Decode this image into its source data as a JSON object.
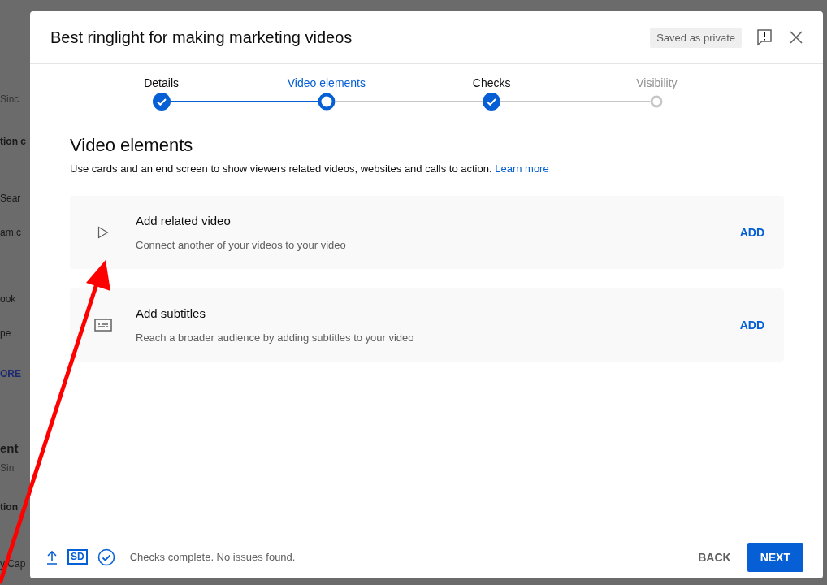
{
  "background_page": {
    "fragments": [
      {
        "text": "Sinc",
        "kind": "muted"
      },
      {
        "text": "tion c",
        "kind": "bold"
      },
      {
        "text": "Sear",
        "kind": "plain"
      },
      {
        "text": "am.c",
        "kind": "plain"
      },
      {
        "text": "ook",
        "kind": "plain"
      },
      {
        "text": "pe",
        "kind": "plain"
      },
      {
        "text": "ORE",
        "kind": "link"
      },
      {
        "text": "ent",
        "kind": "heading"
      },
      {
        "text": "Sin",
        "kind": "muted"
      },
      {
        "text": "tion",
        "kind": "bold"
      },
      {
        "text": "y Cap",
        "kind": "plain"
      }
    ]
  },
  "dialog": {
    "title": "Best ringlight for making marketing videos",
    "save_status": "Saved as private",
    "steps": [
      {
        "label": "Details",
        "completed": true,
        "selected": false
      },
      {
        "label": "Video elements",
        "completed": false,
        "selected": true
      },
      {
        "label": "Checks",
        "completed": true,
        "selected": false
      },
      {
        "label": "Visibility",
        "completed": false,
        "selected": false
      }
    ],
    "heading": "Video elements",
    "description": "Use cards and an end screen to show viewers related videos, websites and calls to action.",
    "learn_more": "Learn more",
    "elements": [
      {
        "kind": "video",
        "title": "Add related video",
        "subtitle": "Connect another of your videos to your video",
        "action": "ADD"
      },
      {
        "kind": "subtitles",
        "title": "Add subtitles",
        "subtitle": "Reach a broader audience by adding subtitles to your video",
        "action": "ADD"
      }
    ],
    "footer": {
      "quality_badge": "SD",
      "status": "Checks complete. No issues found.",
      "back": "BACK",
      "next": "NEXT"
    }
  }
}
